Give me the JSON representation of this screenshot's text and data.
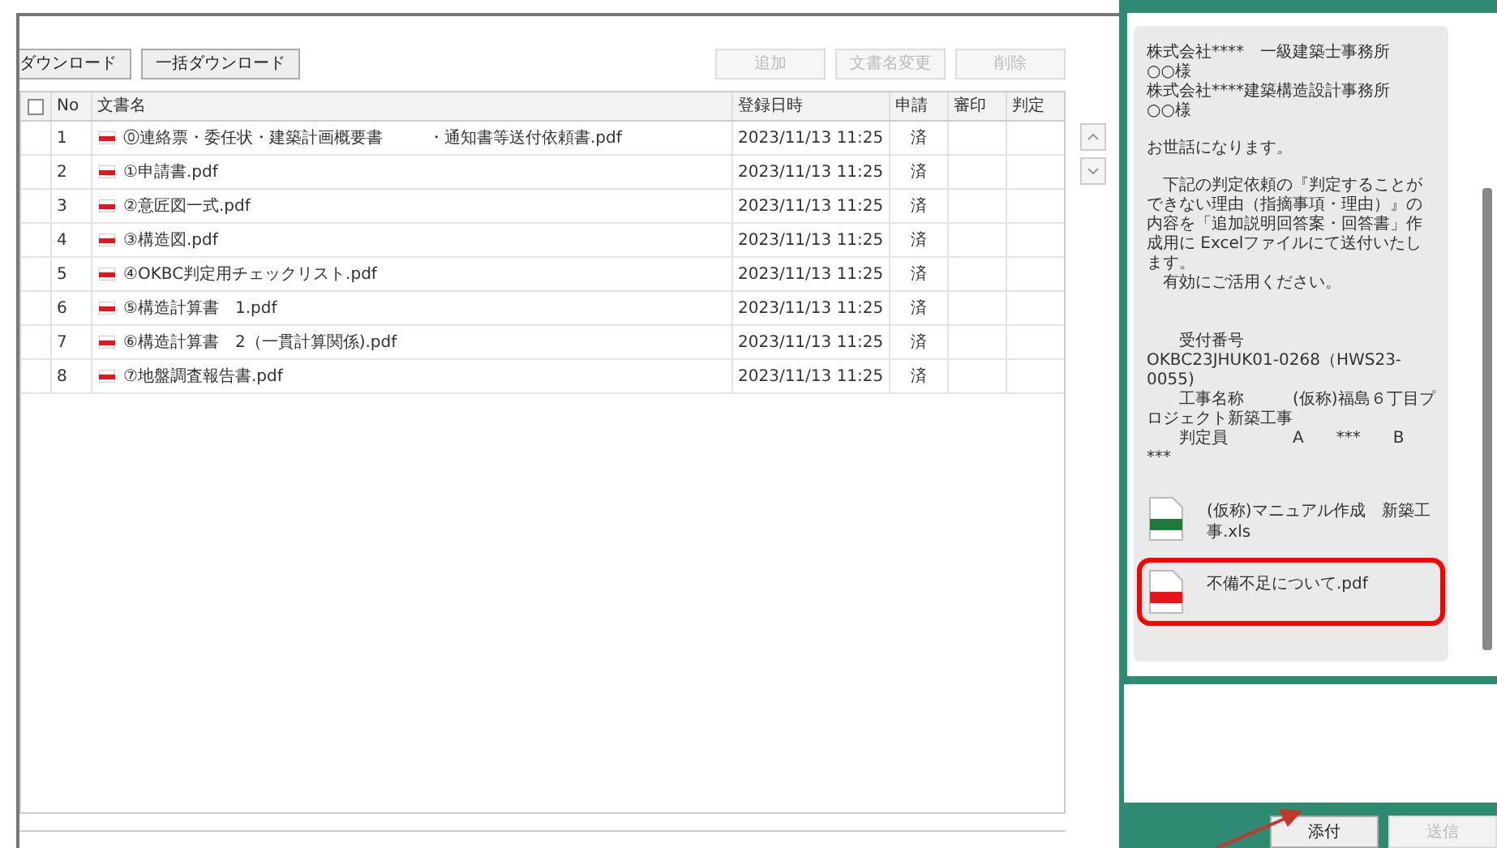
{
  "toolbar": {
    "left_buttons": [
      {
        "label": "ダウンロード",
        "disabled": false
      },
      {
        "label": "一括ダウンロード",
        "disabled": false
      }
    ],
    "right_buttons": [
      {
        "label": "追加",
        "disabled": true
      },
      {
        "label": "文書名変更",
        "disabled": true
      },
      {
        "label": "削除",
        "disabled": true
      }
    ]
  },
  "table": {
    "select_all_checked": false,
    "columns": [
      "No",
      "文書名",
      "登録日時",
      "申請",
      "審印",
      "判定"
    ],
    "rows": [
      {
        "no": "1",
        "name": "⓪連絡票・委任状・建築計画概要書",
        "name_after_gap": "・通知書等送付依頼書.pdf",
        "date": "2023/11/13 11:25",
        "applied": "済"
      },
      {
        "no": "2",
        "name": "①申請書.pdf",
        "date": "2023/11/13 11:25",
        "applied": "済"
      },
      {
        "no": "3",
        "name": "②意匠図一式.pdf",
        "date": "2023/11/13 11:25",
        "applied": "済"
      },
      {
        "no": "4",
        "name": "③構造図.pdf",
        "date": "2023/11/13 11:25",
        "applied": "済"
      },
      {
        "no": "5",
        "name": "④OKBC判定用チェックリスト.pdf",
        "date": "2023/11/13 11:25",
        "applied": "済"
      },
      {
        "no": "6",
        "name": "⑤構造計算書　1.pdf",
        "date": "2023/11/13 11:25",
        "applied": "済"
      },
      {
        "no": "7",
        "name": "⑥構造計算書　2（一貫計算関係).pdf",
        "date": "2023/11/13 11:25",
        "applied": "済"
      },
      {
        "no": "8",
        "name": "⑦地盤調査報告書.pdf",
        "date": "2023/11/13 11:25",
        "applied": "済"
      }
    ]
  },
  "chat": {
    "paragraphs": [
      {
        "kind": "plain",
        "lines": [
          "株式会社****　一級建築士事務所",
          "○○様",
          "株式会社****建築構造設計事務所",
          "○○様"
        ]
      },
      {
        "kind": "plain",
        "lines": [
          "お世話になります。"
        ]
      },
      {
        "kind": "plain",
        "lines": [
          "　下記の判定依頼の『判定することができない理由（指摘事項・理由）』の内容を「追加説明回答案・回答書」作成用に Excelファイルにて送付いたします。",
          "　有効にご活用ください。"
        ]
      },
      {
        "kind": "reference",
        "lines": [
          "　　受付番号",
          "OKBC23JHUK01-0268（HWS23-0055)",
          "　　工事名称　　　(仮称)福島６丁目プロジェクト新築工事",
          "　　判定員　　　　A　　***　　B　***"
        ]
      }
    ],
    "attachments": [
      {
        "name": "(仮称)マニュアル作成　新築工事.xls",
        "kind": "excel",
        "highlighted": false
      },
      {
        "name": "不備不足について.pdf",
        "kind": "pdf",
        "highlighted": true
      }
    ],
    "buttons": [
      {
        "label": "添付",
        "disabled": false
      },
      {
        "label": "送信",
        "disabled": true
      }
    ]
  }
}
